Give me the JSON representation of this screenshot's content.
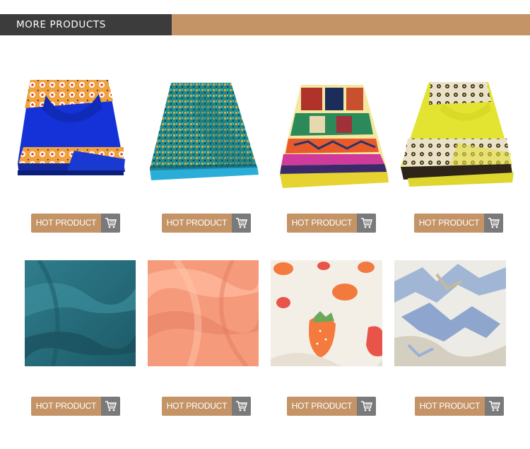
{
  "section": {
    "title": "MORE PRODUCTS"
  },
  "products": [
    {
      "button_label": "HOT PRODUCT",
      "image": "royal-blue-wax-print-fabric"
    },
    {
      "button_label": "HOT PRODUCT",
      "image": "teal-geometric-wax-print-fabric"
    },
    {
      "button_label": "HOT PRODUCT",
      "image": "kente-pattern-wax-print-fabric"
    },
    {
      "button_label": "HOT PRODUCT",
      "image": "yellow-floral-wax-print-fabric"
    },
    {
      "button_label": "HOT PRODUCT",
      "image": "teal-plain-fabric"
    },
    {
      "button_label": "HOT PRODUCT",
      "image": "peach-plain-fabric"
    },
    {
      "button_label": "HOT PRODUCT",
      "image": "strawberry-print-fabric"
    },
    {
      "button_label": "HOT PRODUCT",
      "image": "blue-abstract-print-fabric"
    }
  ],
  "colors": {
    "accent": "#c49467",
    "header_dark": "#3c3c3c",
    "cart_box": "#7a7a7a"
  },
  "icons": {
    "cart": "shopping-cart-icon"
  }
}
